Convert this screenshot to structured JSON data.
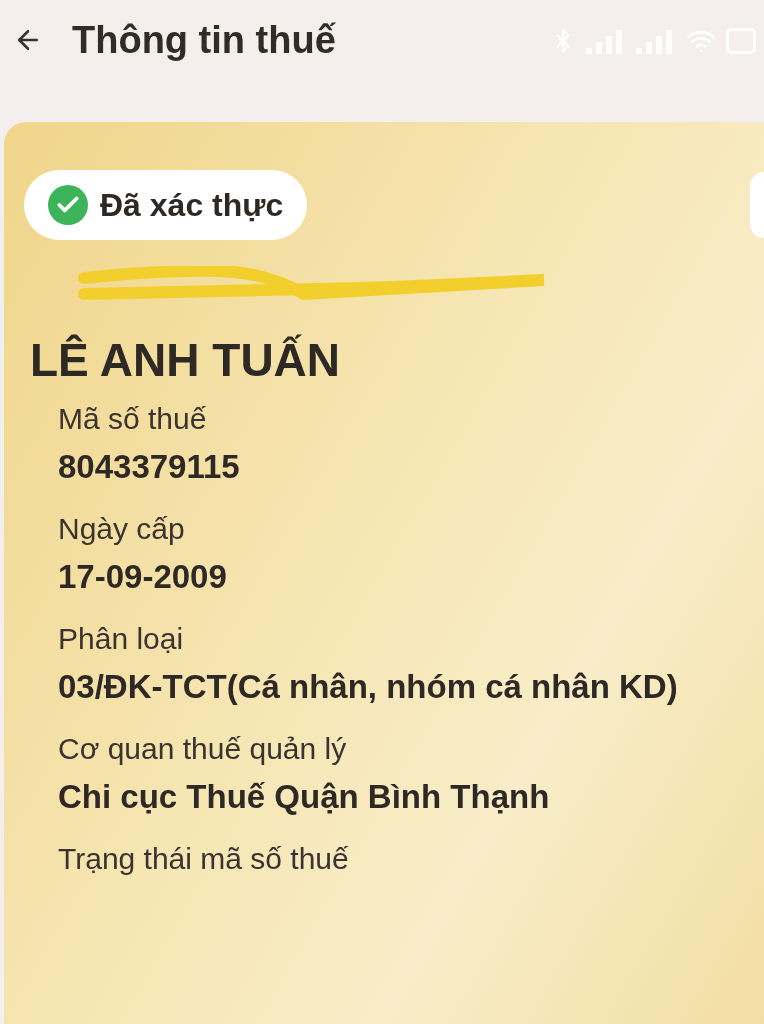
{
  "header": {
    "title": "Thông tin thuế"
  },
  "badge": {
    "label": "Đã xác thực",
    "verified": true
  },
  "name": "LÊ ANH TUẤN",
  "fields": [
    {
      "label": "Mã số thuế",
      "value": "8043379115"
    },
    {
      "label": "Ngày cấp",
      "value": "17-09-2009"
    },
    {
      "label": "Phân loại",
      "value": "03/ĐK-TCT(Cá nhân, nhóm cá nhân KD)"
    },
    {
      "label": "Cơ quan thuế quản lý",
      "value": "Chi cục Thuế Quận Bình Thạnh"
    },
    {
      "label": "Trạng thái mã số thuế"
    }
  ]
}
